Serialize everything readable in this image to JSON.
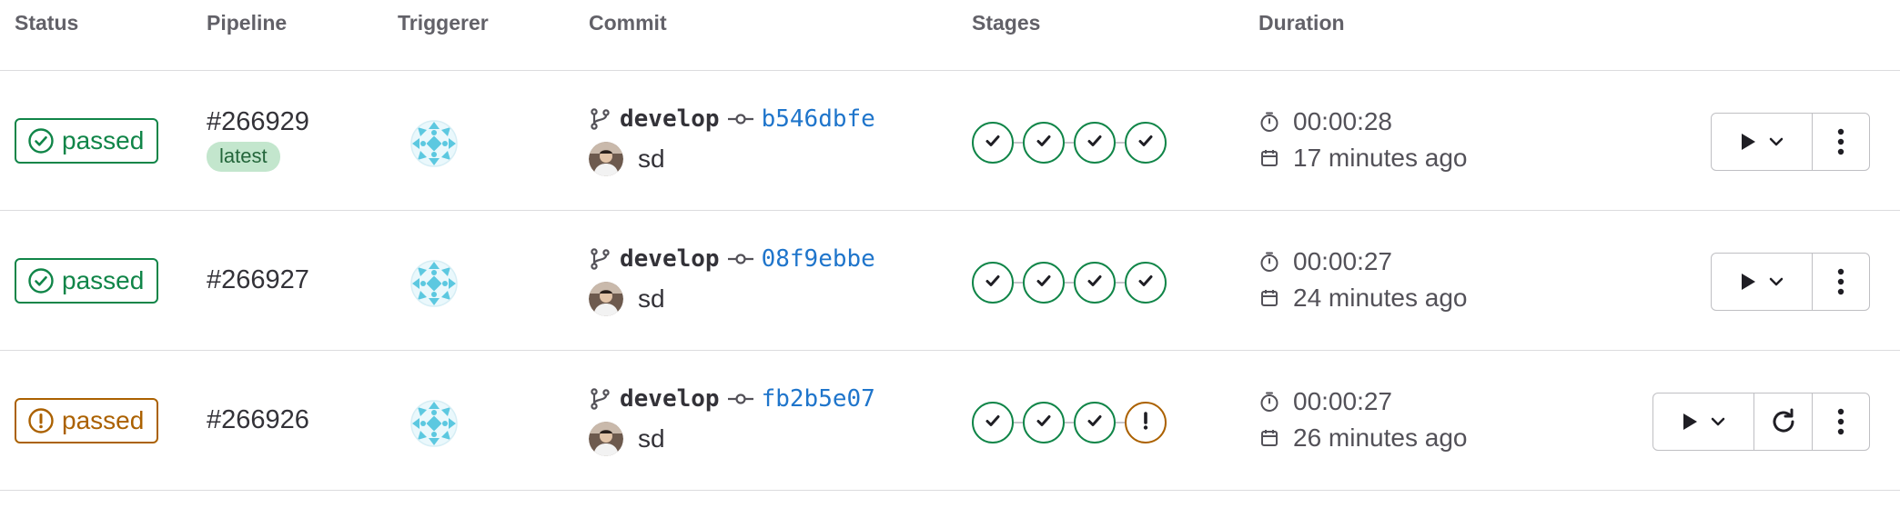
{
  "headers": {
    "status": "Status",
    "pipeline": "Pipeline",
    "triggerer": "Triggerer",
    "commit": "Commit",
    "stages": "Stages",
    "duration": "Duration"
  },
  "rows": [
    {
      "status": "passed",
      "status_kind": "success",
      "pipeline_id": "#266929",
      "latest_badge": "latest",
      "branch": "develop",
      "sha": "b546dbfe",
      "author": "sd",
      "stages": [
        "success",
        "success",
        "success",
        "success"
      ],
      "duration": "00:00:28",
      "finished": "17 minutes ago",
      "actions": [
        "play-menu",
        "more"
      ]
    },
    {
      "status": "passed",
      "status_kind": "success",
      "pipeline_id": "#266927",
      "branch": "develop",
      "sha": "08f9ebbe",
      "author": "sd",
      "stages": [
        "success",
        "success",
        "success",
        "success"
      ],
      "duration": "00:00:27",
      "finished": "24 minutes ago",
      "actions": [
        "play-menu",
        "more"
      ]
    },
    {
      "status": "passed",
      "status_kind": "warning",
      "pipeline_id": "#266926",
      "branch": "develop",
      "sha": "fb2b5e07",
      "author": "sd",
      "stages": [
        "success",
        "success",
        "success",
        "warning"
      ],
      "duration": "00:00:27",
      "finished": "26 minutes ago",
      "actions": [
        "play-menu",
        "retry",
        "more"
      ]
    }
  ],
  "colors": {
    "success": "#108548",
    "warning": "#ab6100",
    "link": "#1f75cb",
    "latest_bg": "#c3e6cd"
  },
  "icons": {
    "status_success": "check-circle-icon",
    "status_warning": "exclamation-circle-icon",
    "branch": "branch-icon",
    "commit": "commit-icon",
    "duration": "timer-icon",
    "finished": "calendar-icon",
    "play": "play-icon",
    "dropdown": "chevron-down-icon",
    "retry": "retry-icon",
    "more": "kebab-menu-icon"
  }
}
